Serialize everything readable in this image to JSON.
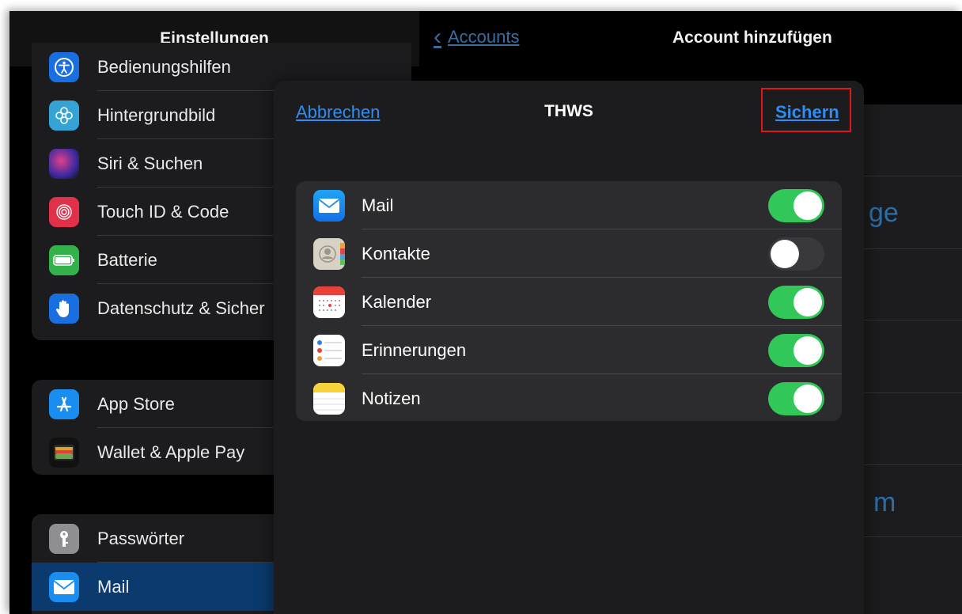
{
  "settings": {
    "title": "Einstellungen",
    "group1": [
      {
        "label": "Bedienungshilfen",
        "icon": "accessibility-icon",
        "color": "#1a6fe0",
        "glyph": "⓵"
      },
      {
        "label": "Hintergrundbild",
        "icon": "wallpaper-icon",
        "color": "#35a3d6",
        "glyph": "❁"
      },
      {
        "label": "Siri & Suchen",
        "icon": "siri-icon",
        "color": "#3a2a6e",
        "glyph": "●"
      },
      {
        "label": "Touch ID & Code",
        "icon": "fingerprint-icon",
        "color": "#e0304a",
        "glyph": "◎"
      },
      {
        "label": "Batterie",
        "icon": "battery-icon",
        "color": "#33b14a",
        "glyph": "▬"
      },
      {
        "label": "Datenschutz & Sicher",
        "icon": "privacy-hand-icon",
        "color": "#1a6fe0",
        "glyph": "✋"
      }
    ],
    "group2": [
      {
        "label": "App Store",
        "icon": "app-store-icon",
        "color": "#1a8ef0",
        "glyph": "A"
      },
      {
        "label": "Wallet & Apple Pay",
        "icon": "wallet-icon",
        "color": "#111111",
        "glyph": "▤"
      }
    ],
    "group3": [
      {
        "label": "Passwörter",
        "icon": "key-icon",
        "color": "#8e8e93",
        "glyph": "⚿"
      },
      {
        "label": "Mail",
        "icon": "mail-icon",
        "color": "#1a8ef0",
        "glyph": "✉"
      }
    ]
  },
  "right": {
    "back_label": "Accounts",
    "title": "Account hinzufügen",
    "fragment_1": "ge",
    "fragment_2": "m"
  },
  "sheet": {
    "cancel_label": "Abbrechen",
    "title": "THWS",
    "save_label": "Sichern",
    "highlight_color": "#e0161b",
    "items": [
      {
        "label": "Mail",
        "icon": "mail-app-icon",
        "on": true
      },
      {
        "label": "Kontakte",
        "icon": "contacts-app-icon",
        "on": false
      },
      {
        "label": "Kalender",
        "icon": "calendar-app-icon",
        "on": true
      },
      {
        "label": "Erinnerungen",
        "icon": "reminders-app-icon",
        "on": true
      },
      {
        "label": "Notizen",
        "icon": "notes-app-icon",
        "on": true
      }
    ]
  }
}
